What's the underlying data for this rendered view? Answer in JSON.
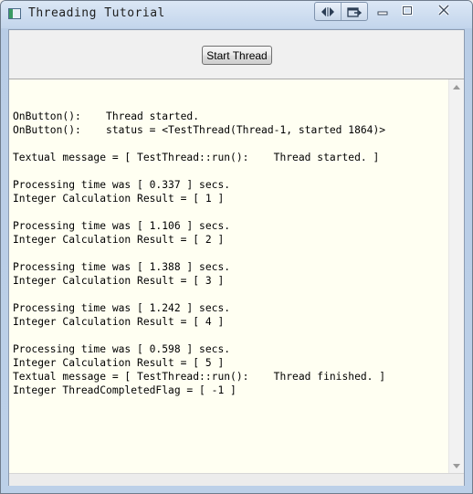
{
  "window": {
    "title": "Threading Tutorial"
  },
  "toolbar": {
    "start_button_label": "Start Thread"
  },
  "output": {
    "lines": [
      "",
      "OnButton():    Thread started.",
      "OnButton():    status = <TestThread(Thread-1, started 1864)>",
      "",
      "Textual message = [ TestThread::run():    Thread started. ]",
      "",
      "Processing time was [ 0.337 ] secs.",
      "Integer Calculation Result = [ 1 ]",
      "",
      "Processing time was [ 1.106 ] secs.",
      "Integer Calculation Result = [ 2 ]",
      "",
      "Processing time was [ 1.388 ] secs.",
      "Integer Calculation Result = [ 3 ]",
      "",
      "Processing time was [ 1.242 ] secs.",
      "Integer Calculation Result = [ 4 ]",
      "",
      "Processing time was [ 0.598 ] secs.",
      "Integer Calculation Result = [ 5 ]",
      "Textual message = [ TestThread::run():    Thread finished. ]",
      "Integer ThreadCompletedFlag = [ -1 ]"
    ]
  },
  "icons": {
    "app": "app-window-icon",
    "swap": "swap-arrows-icon",
    "tray": "tray-arrow-icon",
    "minimize": "minimize-icon",
    "maximize": "maximize-icon",
    "close": "close-icon",
    "scroll_up": "scroll-up-arrow-icon",
    "scroll_down": "scroll-down-arrow-icon"
  },
  "colors": {
    "output_background": "#fffff2",
    "titlebar": "#c3d5ec"
  }
}
